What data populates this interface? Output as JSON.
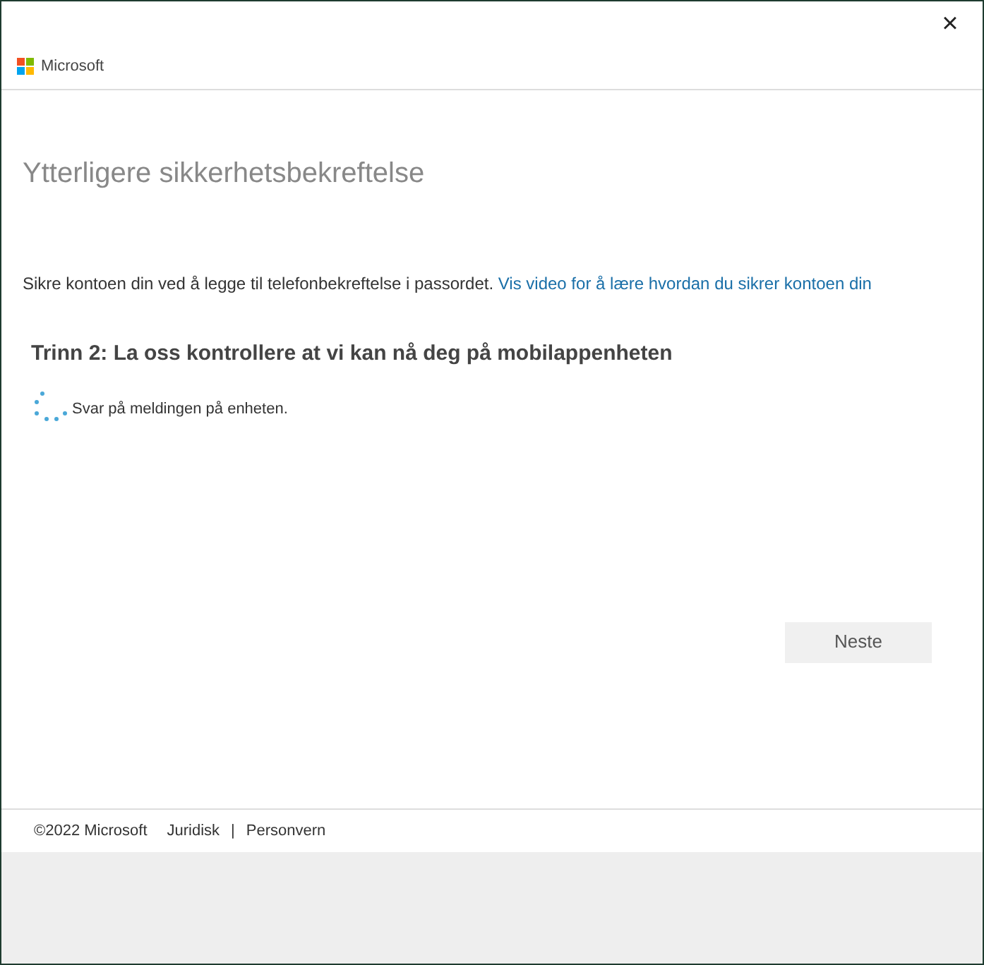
{
  "window": {
    "close": "×"
  },
  "header": {
    "brand": "Microsoft"
  },
  "title": "Ytterligere sikkerhetsbekreftelse",
  "intro": {
    "text": "Sikre kontoen din ved å legge til telefonbekreftelse i passordet.",
    "link": "Vis video for å lære hvordan du sikrer kontoen din"
  },
  "step": {
    "heading": "Trinn 2: La oss kontrollere at vi kan nå deg på mobilappenheten",
    "status": "Svar på meldingen på enheten."
  },
  "button": {
    "label": "Neste",
    "disabled": true
  },
  "footer": {
    "copyright": "©2022 Microsoft",
    "links": [
      "Juridisk",
      "Personvern"
    ],
    "separator": "|"
  }
}
